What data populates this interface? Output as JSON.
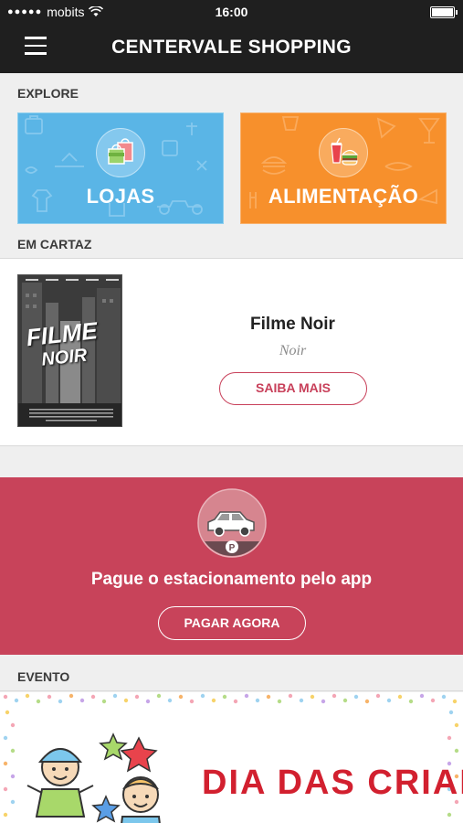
{
  "status_bar": {
    "carrier": "mobits",
    "signal_dots": "●●●●●",
    "time": "16:00"
  },
  "navbar": {
    "title": "CENTERVALE SHOPPING"
  },
  "explore": {
    "label": "EXPLORE",
    "tiles": [
      {
        "label": "LOJAS",
        "icon": "shopping-bags-icon",
        "color": "#5ab5e6"
      },
      {
        "label": "ALIMENTAÇÃO",
        "icon": "food-icon",
        "color": "#f7902c"
      }
    ]
  },
  "em_cartaz": {
    "label": "EM CARTAZ",
    "movie": {
      "poster_title": "FILME",
      "poster_subtitle": "NOIR",
      "title": "Filme Noir",
      "genre": "Noir",
      "button_label": "SAIBA MAIS"
    }
  },
  "parking": {
    "icon": "parking-car-icon",
    "text": "Pague o estacionamento pelo app",
    "button_label": "PAGAR AGORA",
    "color": "#c8435a"
  },
  "evento": {
    "label": "EVENTO",
    "banner_title": "DIA DAS CRIANÇAS"
  }
}
